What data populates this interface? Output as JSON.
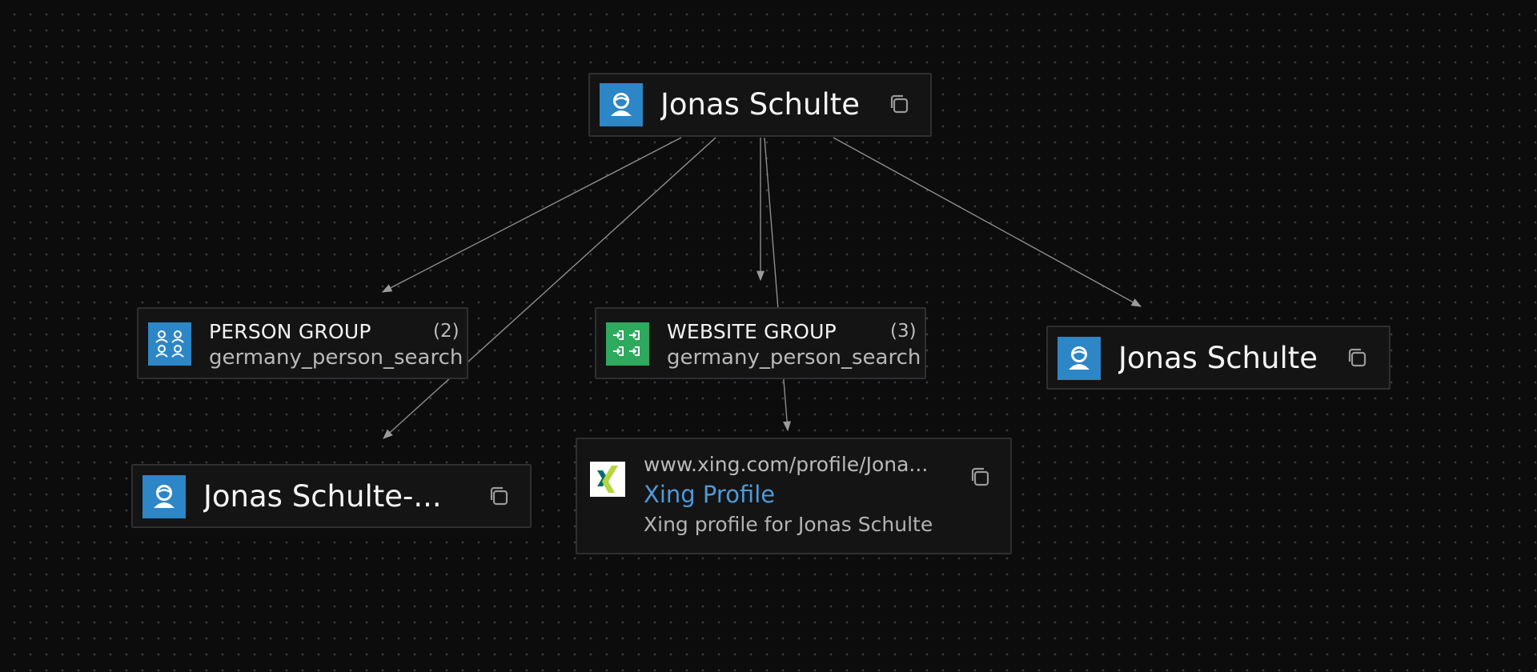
{
  "nodes": {
    "root": {
      "name": "Jonas Schulte",
      "icon": "person-icon"
    },
    "person_group": {
      "title": "PERSON GROUP",
      "count": "(2)",
      "subtitle": "germany_person_search",
      "icon": "people-group-icon"
    },
    "website_group": {
      "title": "WEBSITE GROUP",
      "count": "(3)",
      "subtitle": "germany_person_search",
      "icon": "website-group-icon"
    },
    "person_right": {
      "name": "Jonas Schulte",
      "icon": "person-icon"
    },
    "person_bottom": {
      "name": "Jonas Schulte-...",
      "icon": "person-icon"
    },
    "xing": {
      "url": "www.xing.com/profile/Jona...",
      "title": "Xing Profile",
      "description": "Xing profile for Jonas Schulte",
      "icon": "xing-logo-icon"
    }
  },
  "colors": {
    "person_tile": "#2d86c6",
    "website_tile": "#2fa95e",
    "link": "#4f9ad8",
    "xing_dark": "#0a6a6f",
    "xing_light": "#b5d53c"
  }
}
